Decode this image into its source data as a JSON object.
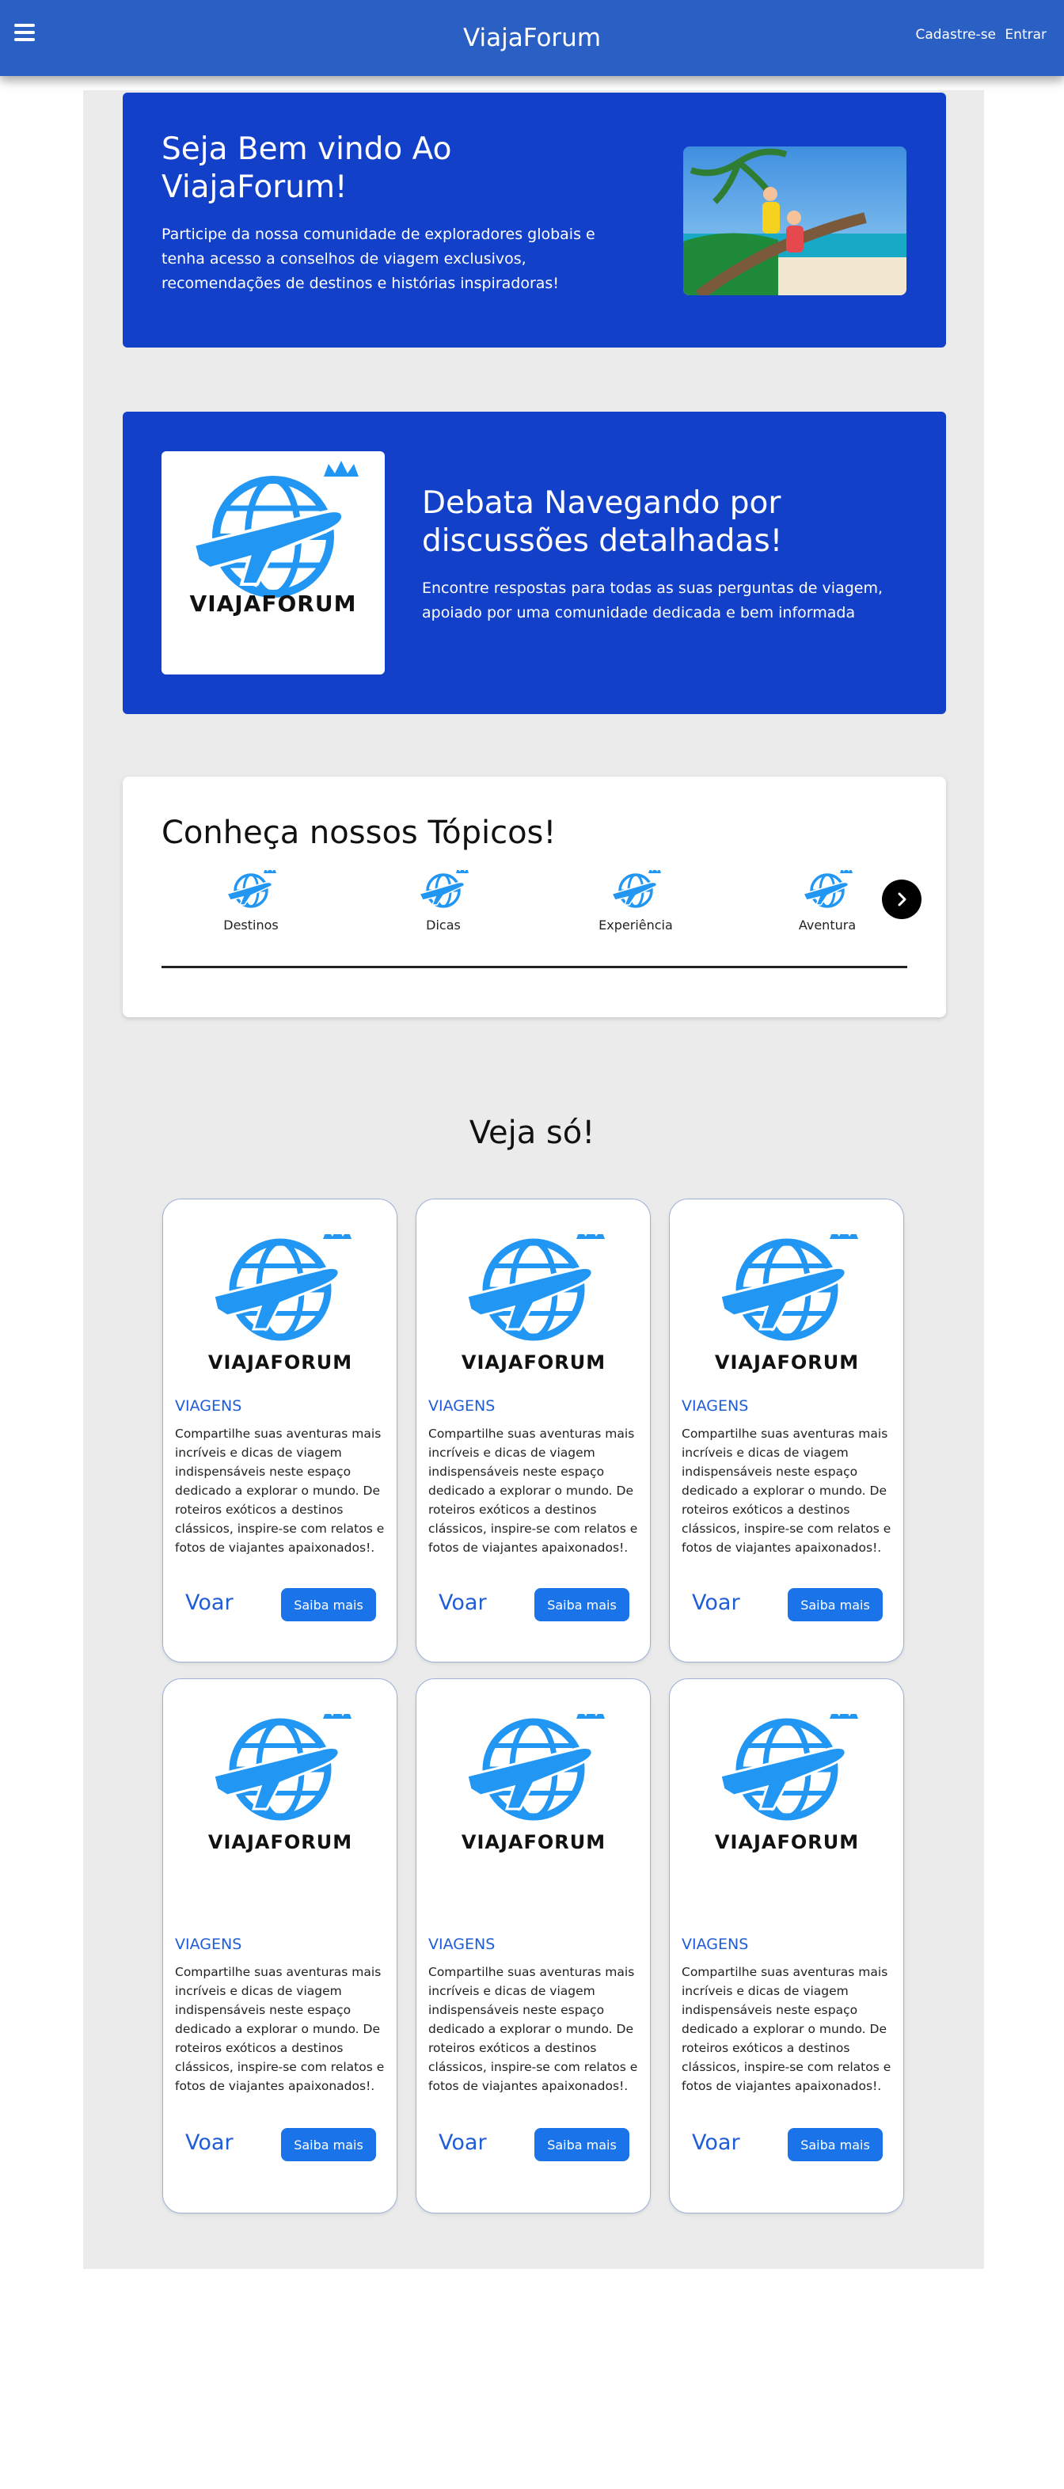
{
  "header": {
    "brand": "ViajaForum",
    "signup": "Cadastre-se",
    "login": "Entrar"
  },
  "hero1": {
    "title": "Seja Bem vindo Ao ViajaForum!",
    "text": "Participe da nossa comunidade de exploradores globais e tenha acesso a conselhos de viagem exclusivos, recomendações de destinos e histórias inspiradoras!"
  },
  "hero2": {
    "logo_text": "VIAJAFORUM",
    "title": "Debata Navegando por discussões detalhadas!",
    "text": "Encontre respostas para todas as suas perguntas de viagem, apoiado por uma comunidade dedicada e bem informada"
  },
  "topics": {
    "title": "Conheça nossos Tópicos!",
    "items": [
      {
        "label": "Destinos"
      },
      {
        "label": "Dicas"
      },
      {
        "label": "Experiência"
      },
      {
        "label": "Aventura"
      }
    ]
  },
  "featured": {
    "title": "Veja só!",
    "cards": [
      {
        "logo_text": "VIAJAFORUM",
        "category": "VIAGENS",
        "text": "Compartilhe suas aventuras mais incríveis e dicas de viagem indispensáveis neste espaço dedicado a explorar o mundo. De roteiros exóticos a destinos clássicos, inspire-se com relatos e fotos de viajantes apaixonados!.",
        "link": "Voar",
        "button": "Saiba mais"
      },
      {
        "logo_text": "VIAJAFORUM",
        "category": "VIAGENS",
        "text": "Compartilhe suas aventuras mais incríveis e dicas de viagem indispensáveis neste espaço dedicado a explorar o mundo. De roteiros exóticos a destinos clássicos, inspire-se com relatos e fotos de viajantes apaixonados!.",
        "link": "Voar",
        "button": "Saiba mais"
      },
      {
        "logo_text": "VIAJAFORUM",
        "category": "VIAGENS",
        "text": "Compartilhe suas aventuras mais incríveis e dicas de viagem indispensáveis neste espaço dedicado a explorar o mundo. De roteiros exóticos a destinos clássicos, inspire-se com relatos e fotos de viajantes apaixonados!.",
        "link": "Voar",
        "button": "Saiba mais"
      },
      {
        "logo_text": "VIAJAFORUM",
        "category": "VIAGENS",
        "text": "Compartilhe suas aventuras mais incríveis e dicas de viagem indispensáveis neste espaço dedicado a explorar o mundo. De roteiros exóticos a destinos clássicos, inspire-se com relatos e fotos de viajantes apaixonados!.",
        "link": "Voar",
        "button": "Saiba mais"
      },
      {
        "logo_text": "VIAJAFORUM",
        "category": "VIAGENS",
        "text": "Compartilhe suas aventuras mais incríveis e dicas de viagem indispensáveis neste espaço dedicado a explorar o mundo. De roteiros exóticos a destinos clássicos, inspire-se com relatos e fotos de viajantes apaixonados!.",
        "link": "Voar",
        "button": "Saiba mais"
      },
      {
        "logo_text": "VIAJAFORUM",
        "category": "VIAGENS",
        "text": "Compartilhe suas aventuras mais incríveis e dicas de viagem indispensáveis neste espaço dedicado a explorar o mundo. De roteiros exóticos a destinos clássicos, inspire-se com relatos e fotos de viajantes apaixonados!.",
        "link": "Voar",
        "button": "Saiba mais"
      }
    ]
  },
  "icons": {
    "menu": "hamburger-menu-icon",
    "logo": "globe-airplane-crown-icon",
    "next": "chevron-right-icon"
  },
  "colors": {
    "header": "#2a5fc4",
    "hero": "#1340c9",
    "accent": "#1f5dd6",
    "button": "#1a73e8",
    "logo_blue": "#2196f3"
  }
}
